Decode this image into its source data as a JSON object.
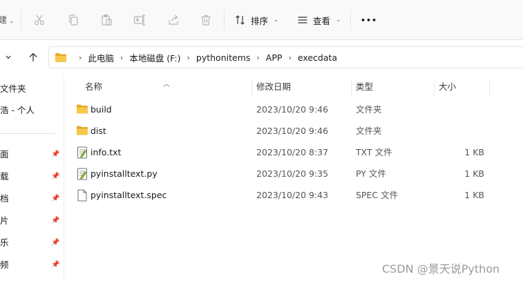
{
  "toolbar": {
    "partial_left_text": "建",
    "sort_label": "排序",
    "view_label": "查看",
    "more_label": "•••",
    "icons": [
      "cut-icon",
      "copy-icon",
      "paste-icon",
      "rename-icon",
      "share-icon",
      "delete-icon"
    ]
  },
  "breadcrumbs": [
    "此电脑",
    "本地磁盘 (F:)",
    "pythonitems",
    "APP",
    "execdata"
  ],
  "nav": {
    "items": [
      {
        "label": "文件夹",
        "pinned": false
      },
      {
        "label": "浩 - 个人",
        "pinned": false
      },
      {
        "label": "面",
        "pinned": true
      },
      {
        "label": "载",
        "pinned": true
      },
      {
        "label": "档",
        "pinned": true
      },
      {
        "label": "片",
        "pinned": true
      },
      {
        "label": "乐",
        "pinned": true
      },
      {
        "label": "频",
        "pinned": true
      }
    ]
  },
  "columns": {
    "name": "名称",
    "date": "修改日期",
    "type": "类型",
    "size": "大小"
  },
  "files": [
    {
      "name": "build",
      "date": "2023/10/20 9:46",
      "type": "文件夹",
      "size": "",
      "icon": "folder-icon"
    },
    {
      "name": "dist",
      "date": "2023/10/20 9:46",
      "type": "文件夹",
      "size": "",
      "icon": "folder-icon"
    },
    {
      "name": "info.txt",
      "date": "2023/10/20 8:37",
      "type": "TXT 文件",
      "size": "1 KB",
      "icon": "text-file-icon"
    },
    {
      "name": "pyinstalltext.py",
      "date": "2023/10/20 9:35",
      "type": "PY 文件",
      "size": "1 KB",
      "icon": "text-file-icon"
    },
    {
      "name": "pyinstalltext.spec",
      "date": "2023/10/20 9:43",
      "type": "SPEC 文件",
      "size": "1 KB",
      "icon": "file-icon"
    }
  ],
  "watermark": "CSDN @景天说Python",
  "colors": {
    "folder": "#f5c143",
    "folder_dark": "#e6a92a",
    "accent": "#0067c0"
  }
}
